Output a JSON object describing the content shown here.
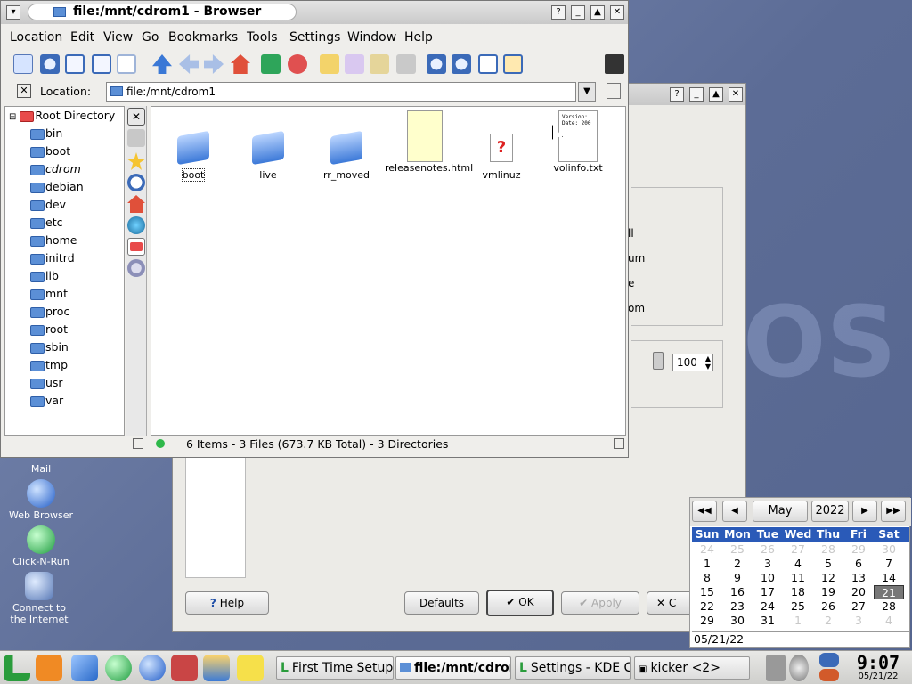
{
  "desktop": {
    "icons": [
      {
        "label": "Mail",
        "icon": "mail-icon"
      },
      {
        "label": "Web Browser",
        "icon": "globe-icon"
      },
      {
        "label": "Click-N-Run",
        "icon": "runner-icon"
      },
      {
        "label": "Connect to the Internet",
        "icon": "network-icon"
      }
    ]
  },
  "settings_window": {
    "slider_value": "100",
    "fragments": [
      "ll",
      "um",
      "e",
      "om"
    ],
    "buttons": {
      "help": "Help",
      "defaults": "Defaults",
      "ok": "OK",
      "apply": "Apply",
      "cancel": "C"
    }
  },
  "browser": {
    "title": "file:/mnt/cdrom1 - Browser",
    "menu": [
      "Location",
      "Edit",
      "View",
      "Go",
      "Bookmarks",
      "Tools",
      "Settings",
      "Window",
      "Help"
    ],
    "location_label": "Location:",
    "location_value": "file:/mnt/cdrom1",
    "tree": {
      "root": "Root Directory",
      "items": [
        "bin",
        "boot",
        "cdrom",
        "debian",
        "dev",
        "etc",
        "home",
        "initrd",
        "lib",
        "mnt",
        "proc",
        "root",
        "sbin",
        "tmp",
        "usr",
        "var"
      ]
    },
    "files": [
      {
        "name": "boot",
        "type": "folder"
      },
      {
        "name": "live",
        "type": "folder"
      },
      {
        "name": "rr_moved",
        "type": "folder"
      },
      {
        "name": "releasenotes.html",
        "type": "html"
      },
      {
        "name": "vmlinuz",
        "type": "unknown"
      },
      {
        "name": "volinfo.txt",
        "type": "text",
        "preview": "Version:\nDate: 200"
      }
    ],
    "status": "6 Items - 3 Files (673.7 KB Total) - 3 Directories"
  },
  "calendar": {
    "month": "May",
    "year": "2022",
    "weekdays": [
      "Sun",
      "Mon",
      "Tue",
      "Wed",
      "Thu",
      "Fri",
      "Sat"
    ],
    "weeks": [
      [
        "24",
        "25",
        "26",
        "27",
        "28",
        "29",
        "30"
      ],
      [
        "1",
        "2",
        "3",
        "4",
        "5",
        "6",
        "7"
      ],
      [
        "8",
        "9",
        "10",
        "11",
        "12",
        "13",
        "14"
      ],
      [
        "15",
        "16",
        "17",
        "18",
        "19",
        "20",
        "21"
      ],
      [
        "22",
        "23",
        "24",
        "25",
        "26",
        "27",
        "28"
      ],
      [
        "29",
        "30",
        "31",
        "1",
        "2",
        "3",
        "4"
      ]
    ],
    "selected": "21",
    "date_field": "05/21/22"
  },
  "taskbar": {
    "tasks": [
      "First Time Setup",
      "file:/mnt/cdrom",
      "Settings - KDE C",
      "kicker <2>"
    ],
    "time": "9:07",
    "date": "05/21/22"
  },
  "colors": {
    "accent": "#2a5ab8",
    "folder": "#5b8fd6"
  }
}
